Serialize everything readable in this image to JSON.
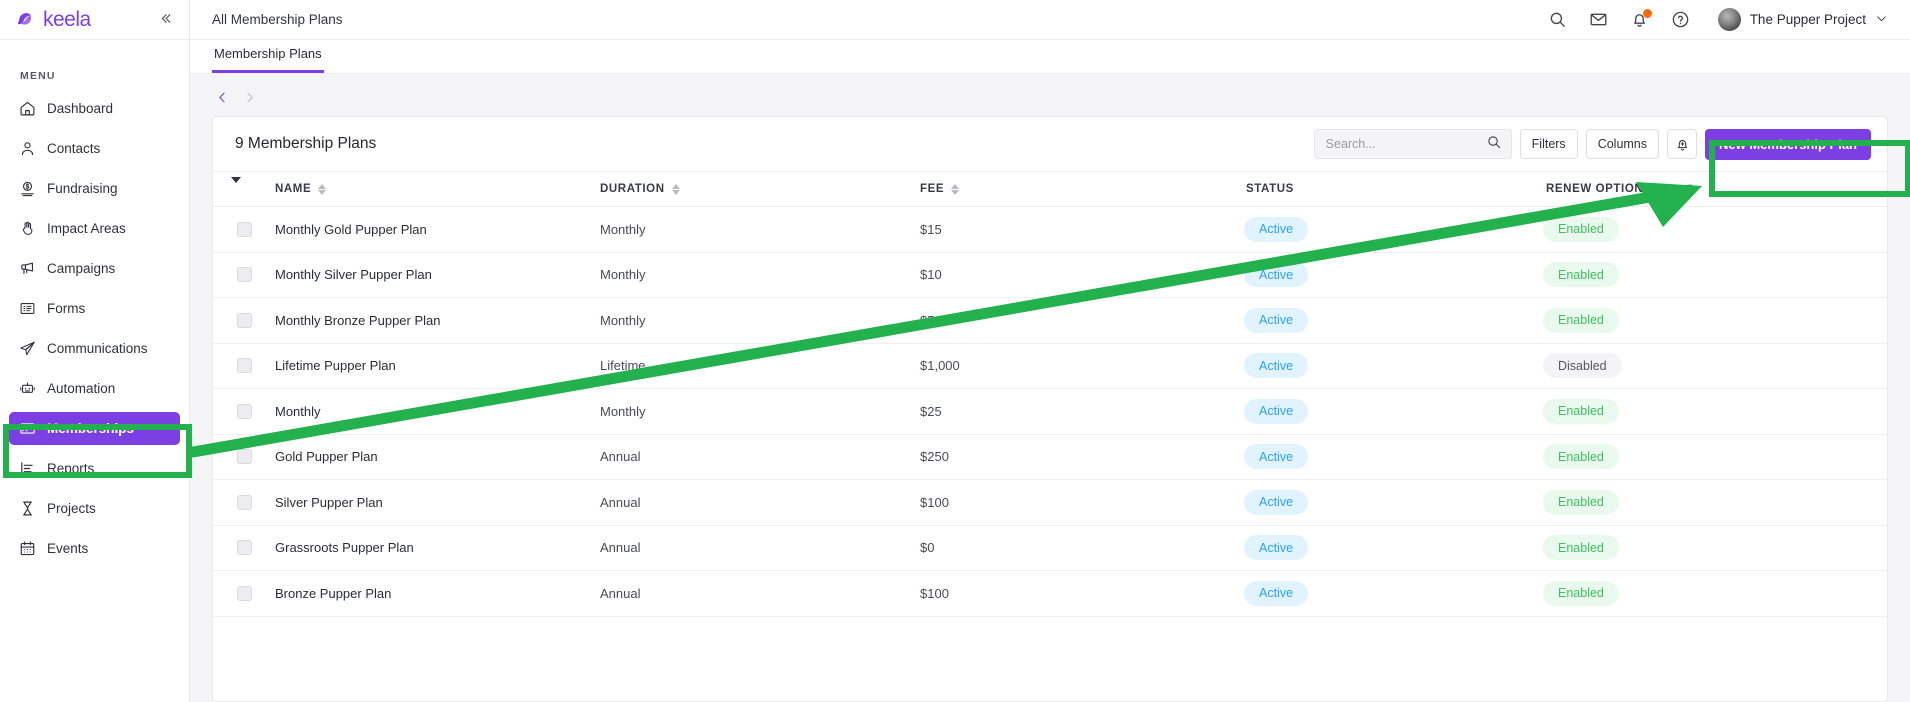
{
  "sidebar": {
    "brand": "keela",
    "collapse_icon": "chevrons-left-icon",
    "menu_heading": "MENU",
    "items": [
      {
        "label": "Dashboard",
        "icon": "home-icon",
        "active": false
      },
      {
        "label": "Contacts",
        "icon": "user-icon",
        "active": false
      },
      {
        "label": "Fundraising",
        "icon": "donation-icon",
        "active": false
      },
      {
        "label": "Impact Areas",
        "icon": "hand-icon",
        "active": false
      },
      {
        "label": "Campaigns",
        "icon": "megaphone-icon",
        "active": false
      },
      {
        "label": "Forms",
        "icon": "form-list-icon",
        "active": false
      },
      {
        "label": "Communications",
        "icon": "paper-plane-icon",
        "active": false
      },
      {
        "label": "Automation",
        "icon": "robot-icon",
        "active": false
      },
      {
        "label": "Memberships",
        "icon": "id-card-icon",
        "active": true
      },
      {
        "label": "Reports",
        "icon": "bar-chart-icon",
        "active": false
      },
      {
        "label": "Projects",
        "icon": "hourglass-icon",
        "active": false
      },
      {
        "label": "Events",
        "icon": "calendar-icon",
        "active": false
      }
    ]
  },
  "header": {
    "breadcrumb": "All Membership Plans",
    "icons": [
      "search-icon",
      "mail-icon",
      "bell-icon",
      "help-circle-icon"
    ],
    "notification_dot": true,
    "org_name": "The Pupper Project",
    "org_caret": "chevron-down-icon"
  },
  "tabs": [
    {
      "label": "Membership Plans",
      "active": true
    }
  ],
  "pager": {
    "prev_icon": "chevron-left-icon",
    "next_icon": "chevron-right-icon"
  },
  "toolbar": {
    "title": "9 Membership Plans",
    "search_placeholder": "Search...",
    "search_value": "",
    "search_icon": "search-icon",
    "filters_label": "Filters",
    "columns_label": "Columns",
    "alert_icon": "bell-plus-icon",
    "new_button_label": "New Membership Plan"
  },
  "table": {
    "columns": [
      {
        "key": "checkbox",
        "label": "",
        "sortable": false
      },
      {
        "key": "name",
        "label": "NAME",
        "sortable": true
      },
      {
        "key": "duration",
        "label": "DURATION",
        "sortable": true
      },
      {
        "key": "fee",
        "label": "FEE",
        "sortable": true
      },
      {
        "key": "status",
        "label": "STATUS",
        "sortable": false
      },
      {
        "key": "renew",
        "label": "RENEW OPTION",
        "sortable": false
      }
    ],
    "rows": [
      {
        "name": "Monthly Gold Pupper Plan",
        "duration": "Monthly",
        "fee": "$15",
        "status": "Active",
        "renew": "Enabled"
      },
      {
        "name": "Monthly Silver Pupper Plan",
        "duration": "Monthly",
        "fee": "$10",
        "status": "Active",
        "renew": "Enabled"
      },
      {
        "name": "Monthly Bronze Pupper Plan",
        "duration": "Monthly",
        "fee": "$5",
        "status": "Active",
        "renew": "Enabled"
      },
      {
        "name": "Lifetime Pupper Plan",
        "duration": "Lifetime",
        "fee": "$1,000",
        "status": "Active",
        "renew": "Disabled"
      },
      {
        "name": "Monthly",
        "duration": "Monthly",
        "fee": "$25",
        "status": "Active",
        "renew": "Enabled"
      },
      {
        "name": "Gold Pupper Plan",
        "duration": "Annual",
        "fee": "$250",
        "status": "Active",
        "renew": "Enabled"
      },
      {
        "name": "Silver Pupper Plan",
        "duration": "Annual",
        "fee": "$100",
        "status": "Active",
        "renew": "Enabled"
      },
      {
        "name": "Grassroots Pupper Plan",
        "duration": "Annual",
        "fee": "$0",
        "status": "Active",
        "renew": "Enabled"
      },
      {
        "name": "Bronze Pupper Plan",
        "duration": "Annual",
        "fee": "$100",
        "status": "Active",
        "renew": "Enabled"
      }
    ]
  },
  "annotation": {
    "color": "#22b14c",
    "highlight_boxes": [
      "memberships-sidebar-item",
      "new-membership-plan-button"
    ],
    "arrow": "from-memberships-to-new-membership-plan-button"
  },
  "colors": {
    "brand_purple": "#7b3fe4",
    "active_badge_bg": "#e1f3fe",
    "active_badge_fg": "#2aa3f5",
    "enabled_badge_bg": "#eaf9ee",
    "enabled_badge_fg": "#3fbf5e",
    "disabled_badge_bg": "#f4f4f6",
    "disabled_badge_fg": "#55555f",
    "annotation_green": "#22b14c",
    "notification_orange": "#f96c0d"
  }
}
